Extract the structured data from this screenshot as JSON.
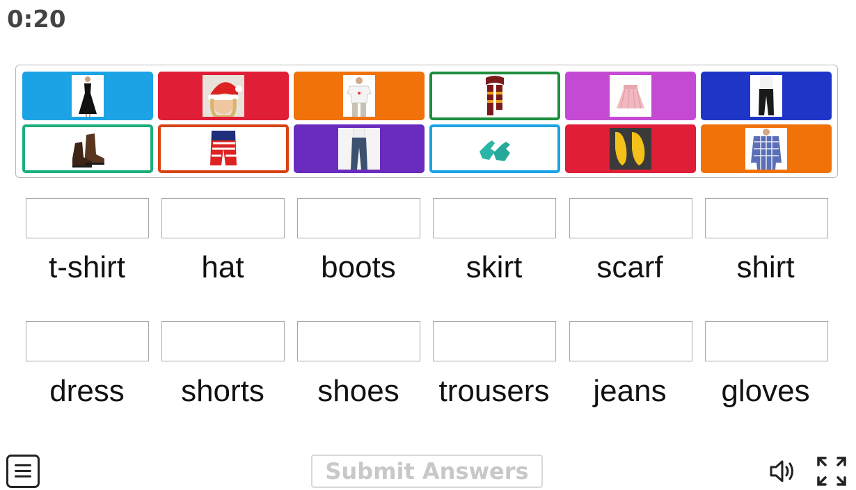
{
  "timer": "0:20",
  "tiles": [
    {
      "name": "tile-dress",
      "icon": "dress-icon",
      "color": "#1ba3e6",
      "style": "filled"
    },
    {
      "name": "tile-hat",
      "icon": "santa-hat-icon",
      "color": "#e01e37",
      "style": "filled"
    },
    {
      "name": "tile-tshirt",
      "icon": "tshirt-icon",
      "color": "#f07208",
      "style": "filled"
    },
    {
      "name": "tile-scarf",
      "icon": "scarf-icon",
      "color": "#1e8e3e",
      "style": "outlined"
    },
    {
      "name": "tile-skirt",
      "icon": "skirt-icon",
      "color": "#c44ad4",
      "style": "filled"
    },
    {
      "name": "tile-trousers",
      "icon": "trousers-icon",
      "color": "#1f35c8",
      "style": "filled"
    },
    {
      "name": "tile-boots",
      "icon": "boots-icon",
      "color": "#1aaf7a",
      "style": "outlined"
    },
    {
      "name": "tile-shorts",
      "icon": "shorts-icon",
      "color": "#d84315",
      "style": "outlined"
    },
    {
      "name": "tile-jeans",
      "icon": "jeans-icon",
      "color": "#6a2bbf",
      "style": "filled"
    },
    {
      "name": "tile-gloves",
      "icon": "gloves-icon",
      "color": "#1ba3e6",
      "style": "outlined"
    },
    {
      "name": "tile-shoes",
      "icon": "shoes-icon",
      "color": "#e01e37",
      "style": "filled"
    },
    {
      "name": "tile-shirt",
      "icon": "shirt-icon",
      "color": "#f07208",
      "style": "filled"
    }
  ],
  "words_row1": [
    "t-shirt",
    "hat",
    "boots",
    "skirt",
    "scarf",
    "shirt"
  ],
  "words_row2": [
    "dress",
    "shorts",
    "shoes",
    "trousers",
    "jeans",
    "gloves"
  ],
  "submit_label": "Submit Answers",
  "controls": {
    "menu_icon": "menu-icon",
    "sound_icon": "speaker-icon",
    "fullscreen_icon": "fullscreen-icon"
  }
}
